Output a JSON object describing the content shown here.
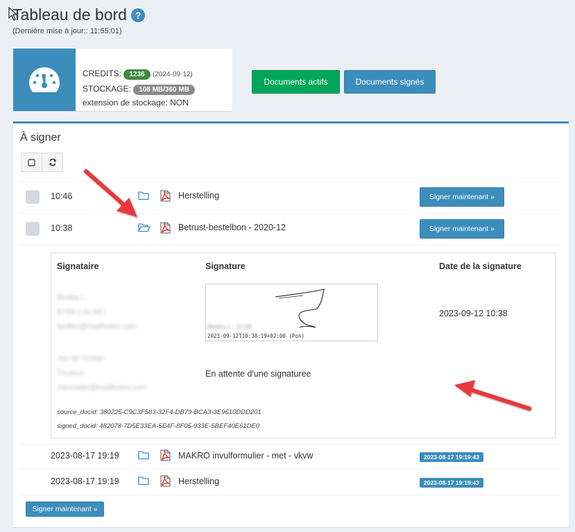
{
  "header": {
    "title": "Tableau de bord",
    "help_icon": "?",
    "last_update": "(Dernière mise à jour:: 11:55:01)"
  },
  "info_box": {
    "icon": "dashboard-gauge-icon",
    "credits_label": "CREDITS:",
    "credits_value": "1236",
    "credits_date": "(2024-09-12)",
    "storage_label": "STOCKAGE:",
    "storage_value": "108 MB/360 MB",
    "extension_text": "extension de stockage: NON"
  },
  "actions": {
    "active_docs": "Documents actifs",
    "signed_docs": "Documents signés"
  },
  "panel": {
    "title": "À signer",
    "rows": [
      {
        "time": "10:46",
        "name": "Herstelling",
        "action": "Signer maintenant »"
      },
      {
        "time": "10:38",
        "name": "Betrust-bestelbon - 2020-12",
        "action": "Signer maintenant »"
      }
    ],
    "detail": {
      "headers": {
        "signer": "Signataire",
        "signature": "Signature",
        "date": "Date de la signature"
      },
      "signer1": {
        "name": "Bedea L",
        "company": "B769 1 DLMC",
        "email": "bedlen@mailhotes.com"
      },
      "signer2": {
        "name": "Jan de Coster",
        "company": "Thuisco",
        "email": "Jancoster@mailhotes.com"
      },
      "signature_caption": "2023-09-12T10:38:19+02:00 (Pon)",
      "signature_blur": "Bedea L - 10:38",
      "signature_date": "2023-09-12 10:38",
      "waiting": "En attente d'une signaturee",
      "source_docid": "source_docid: 380225-C9C3F583-32F4-DB79-BCA3-3E9610DDD201",
      "signed_docid": "signed_docid: 482078-7D5E33EA-5E4F-8F05-933E-5BEF40E61DE0"
    },
    "signed_rows": [
      {
        "time": "2023-08-17 19:19",
        "name": "MAKRO invulformulier - met - vkvw",
        "badge": "2023-08-17 19:19:43"
      },
      {
        "time": "2023-08-17 19:19",
        "name": "Herstelling",
        "badge": "2023-08-17 19:19:43"
      }
    ],
    "bottom_action": "Signer maintenant »"
  },
  "colors": {
    "primary": "#3c8dbc",
    "success": "#00a65a",
    "annotation_arrow": "#e8383d",
    "badge_green": "#3d8b3d",
    "badge_gray": "#8a8a8a"
  }
}
